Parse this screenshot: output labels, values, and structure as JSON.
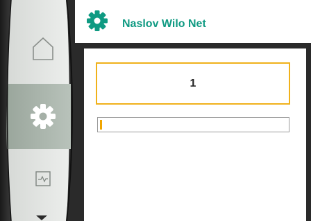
{
  "header": {
    "title": "Naslov Wilo Net",
    "icon": "gear-icon",
    "title_color": "#0f9a82"
  },
  "nav": {
    "items": [
      {
        "name": "home",
        "icon": "home-icon",
        "selected": false
      },
      {
        "name": "settings",
        "icon": "gear-icon",
        "selected": true
      },
      {
        "name": "diagnostics",
        "icon": "pulse-icon",
        "selected": false
      }
    ],
    "scroll_down_icon": "triangle-down-icon"
  },
  "editor": {
    "value": "1",
    "accent_color": "#f0b11a",
    "progress_fraction": 0.01
  }
}
